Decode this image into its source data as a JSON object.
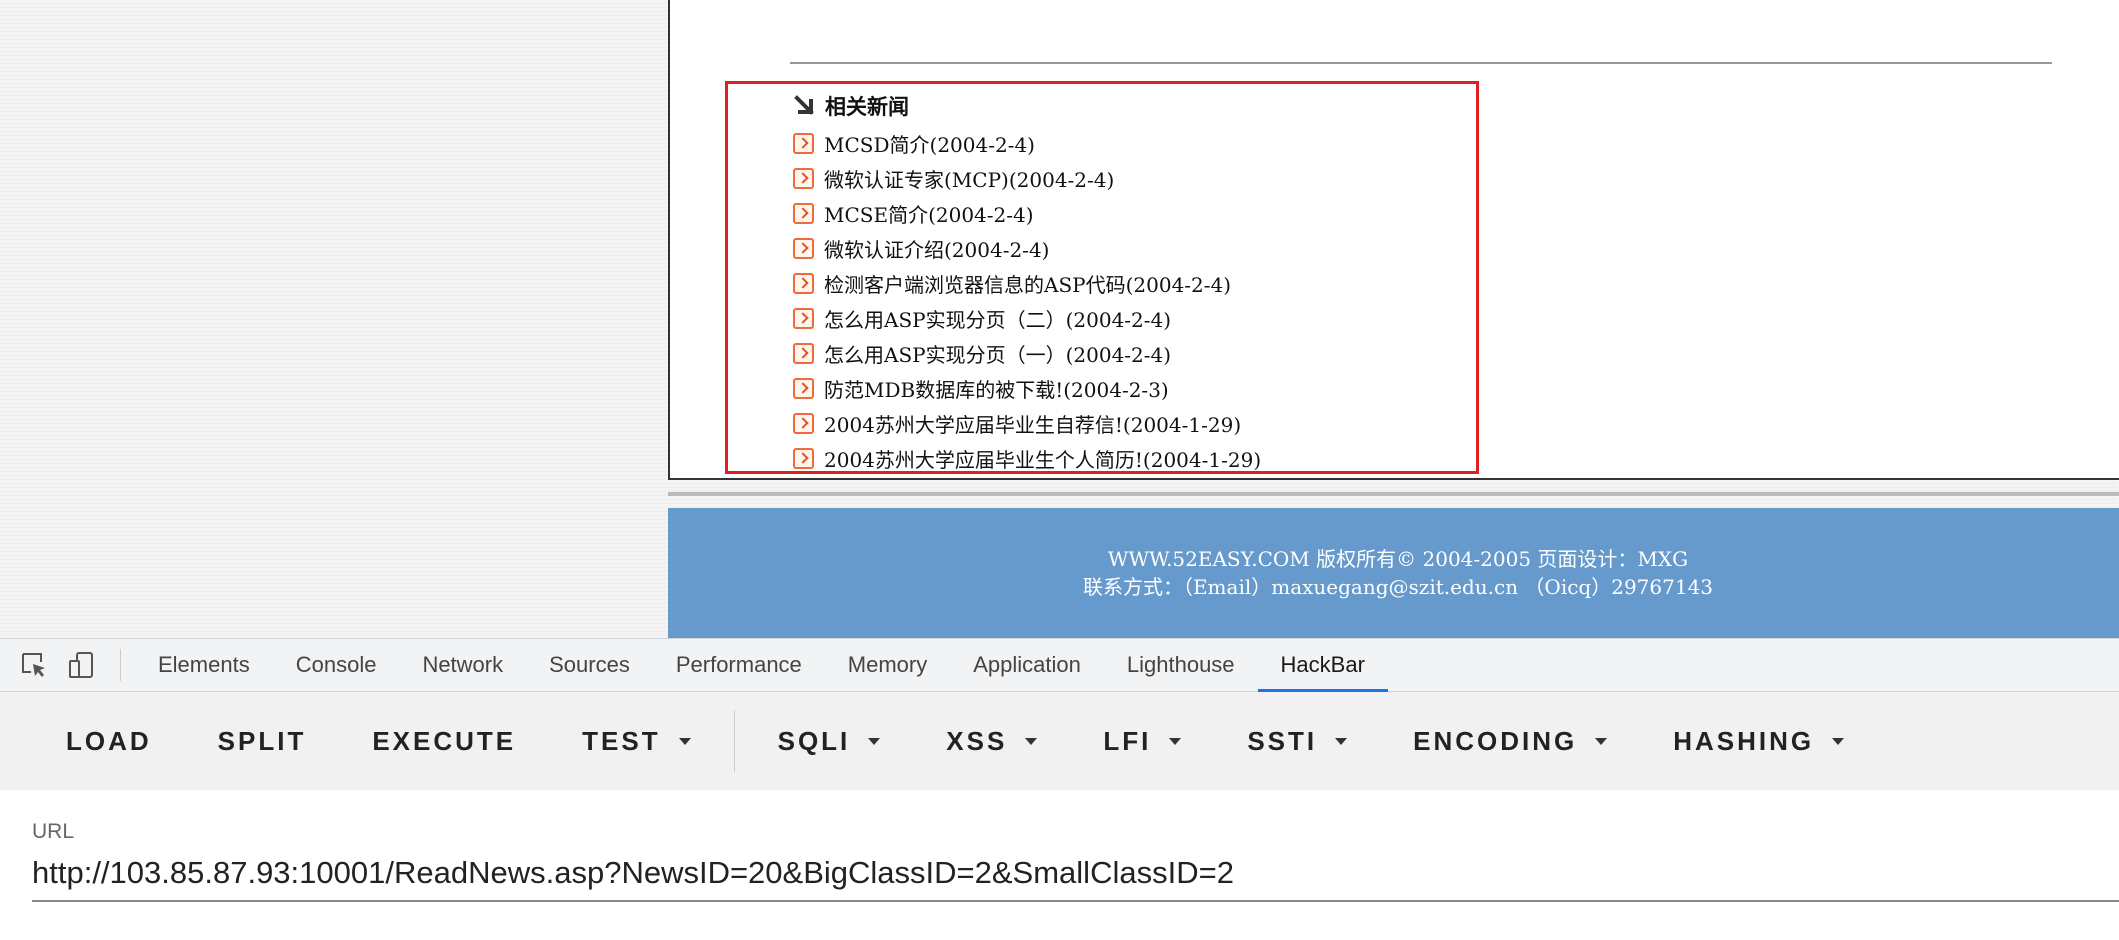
{
  "page": {
    "related_title": "相关新闻",
    "news_items": [
      "MCSD简介(2004-2-4)",
      "微软认证专家(MCP)(2004-2-4)",
      "MCSE简介(2004-2-4)",
      "微软认证介绍(2004-2-4)",
      "检测客户端浏览器信息的ASP代码(2004-2-4)",
      "怎么用ASP实现分页（二）(2004-2-4)",
      "怎么用ASP实现分页（一）(2004-2-4)",
      "防范MDB数据库的被下载!(2004-2-3)",
      "2004苏州大学应届毕业生自荐信!(2004-1-29)",
      "2004苏州大学应届毕业生个人简历!(2004-1-29)"
    ],
    "footer_line1": "WWW.52EASY.COM 版权所有© 2004-2005 页面设计：MXG",
    "footer_line2": "联系方式：（Email）maxuegang@szit.edu.cn （Oicq）29767143",
    "highlight_color": "#e02020",
    "footer_color": "#6699cc"
  },
  "devtools": {
    "icons": [
      "inspect-element-icon",
      "device-toolbar-icon"
    ],
    "tabs": [
      "Elements",
      "Console",
      "Network",
      "Sources",
      "Performance",
      "Memory",
      "Application",
      "Lighthouse",
      "HackBar"
    ],
    "active_tab": "HackBar"
  },
  "hackbar": {
    "buttons": {
      "load": "LOAD",
      "split": "SPLIT",
      "execute": "EXECUTE",
      "test": "TEST",
      "sqli": "SQLI",
      "xss": "XSS",
      "lfi": "LFI",
      "ssti": "SSTI",
      "encoding": "ENCODING",
      "hashing": "HASHING"
    },
    "url_label": "URL",
    "url_value": "http://103.85.87.93:10001/ReadNews.asp?NewsID=20&BigClassID=2&SmallClassID=2"
  }
}
